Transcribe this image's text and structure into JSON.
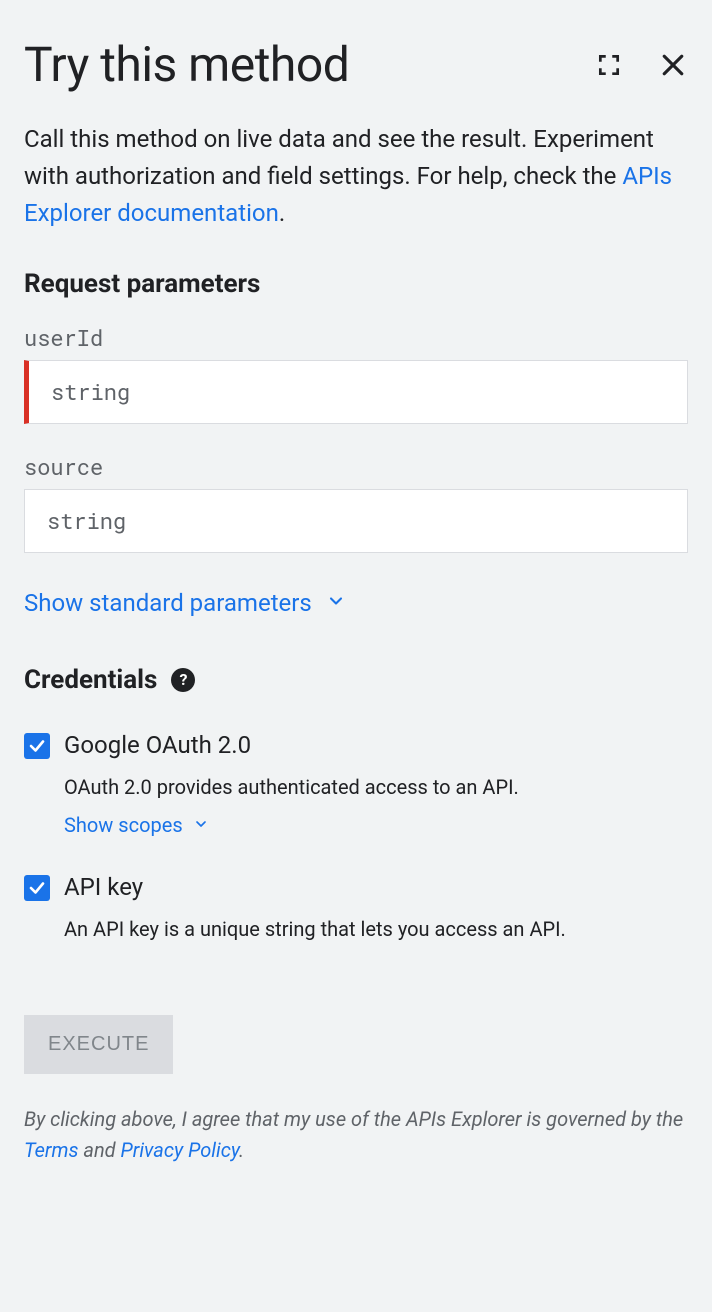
{
  "header": {
    "title": "Try this method"
  },
  "description": {
    "text_before_link": "Call this method on live data and see the result. Experiment with authorization and field settings. For help, check the ",
    "link_text": "APIs Explorer documentation",
    "text_after_link": "."
  },
  "params": {
    "heading": "Request parameters",
    "fields": {
      "userId": {
        "label": "userId",
        "placeholder": "string"
      },
      "source": {
        "label": "source",
        "placeholder": "string"
      }
    },
    "show_standard_label": "Show standard parameters"
  },
  "credentials": {
    "heading": "Credentials",
    "oauth": {
      "label": "Google OAuth 2.0",
      "description": "OAuth 2.0 provides authenticated access to an API.",
      "show_scopes_label": "Show scopes"
    },
    "apikey": {
      "label": "API key",
      "description": "An API key is a unique string that lets you access an API."
    }
  },
  "execute_label": "EXECUTE",
  "disclaimer": {
    "before_terms": "By clicking above, I agree that my use of the APIs Explorer is governed by the ",
    "terms_label": "Terms",
    "between": " and ",
    "privacy_label": "Privacy Policy",
    "after": "."
  }
}
